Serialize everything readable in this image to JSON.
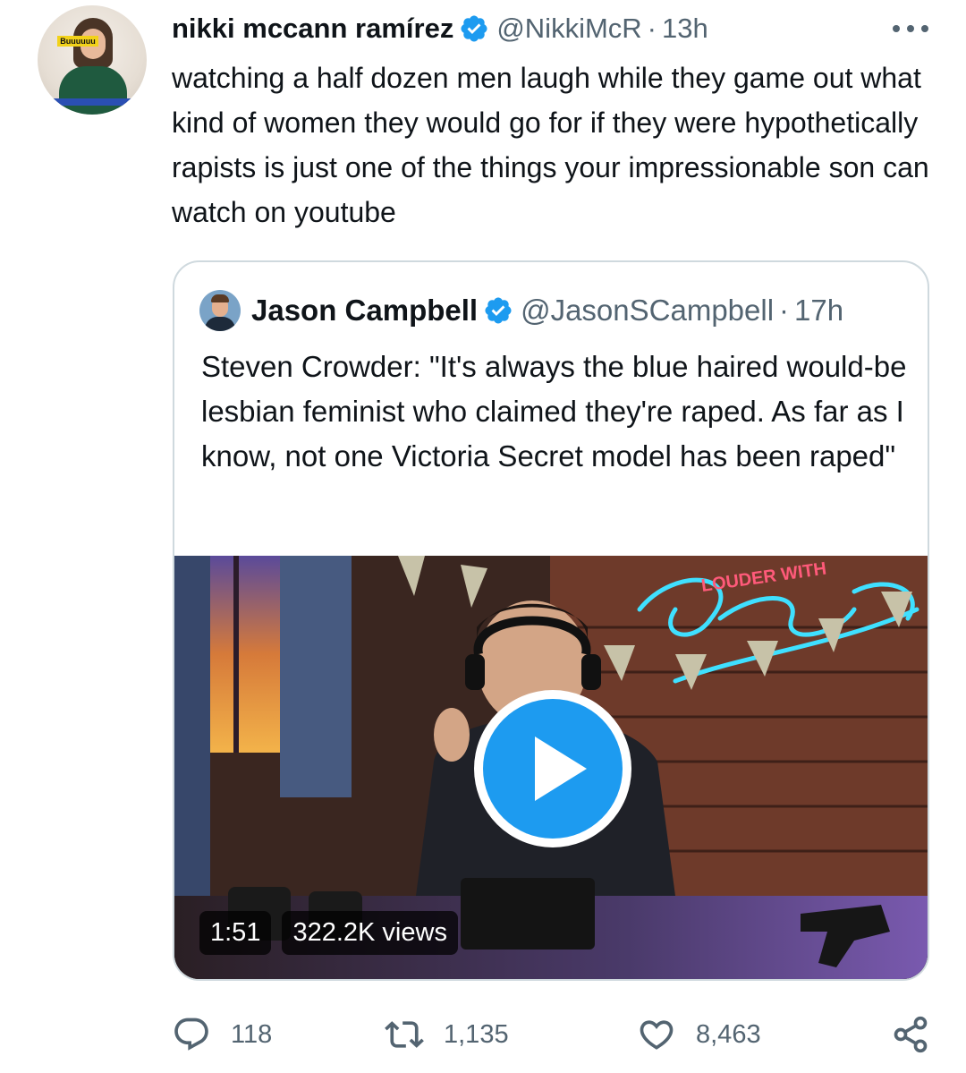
{
  "tweet": {
    "avatar_banner": "Buuuuuu",
    "display_name": "nikki mccann ramírez",
    "handle": "@NikkiMcR",
    "separator": "·",
    "time": "13h",
    "text": "watching a half dozen men laugh while they game out what kind of women they would go for if they were hypothetically rapists is just one of the things your impressionable son can watch on youtube"
  },
  "quote": {
    "display_name": "Jason Campbell",
    "handle": "@JasonSCampbell",
    "separator": "·",
    "time": "17h",
    "text": "Steven Crowder: \"It's always the blue haired would-be lesbian feminist who claimed they're raped. As far as I know, not one Victoria Secret model has been raped\"",
    "video": {
      "duration": "1:51",
      "views": "322.2K views",
      "sign_text": "LOUDER WITH"
    }
  },
  "actions": {
    "replies": "118",
    "retweets": "1,135",
    "likes": "8,463"
  },
  "colors": {
    "accent": "#1d9bf0",
    "text_primary": "#0f1419",
    "text_secondary": "#536471",
    "border": "#cfd9de"
  },
  "icons": [
    "verified-badge-icon",
    "more-icon",
    "play-icon",
    "reply-icon",
    "retweet-icon",
    "like-icon",
    "share-icon"
  ]
}
